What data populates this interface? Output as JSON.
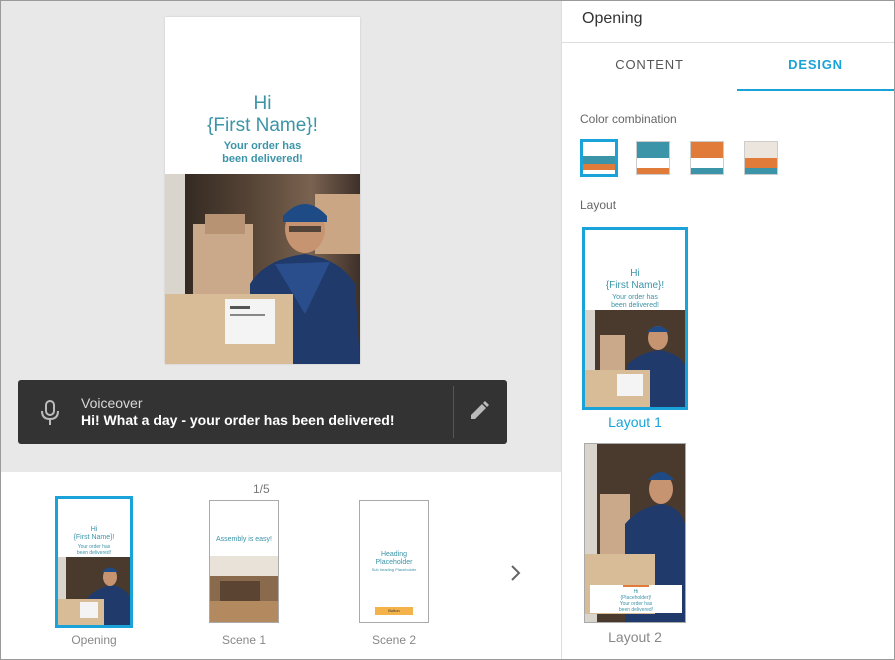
{
  "preview": {
    "hi": "Hi",
    "name": "{First Name}!",
    "sub_line1": "Your order has",
    "sub_line2": "been delivered!"
  },
  "voiceover": {
    "title": "Voiceover",
    "text": "Hi! What a day - your order has been delivered!"
  },
  "scenes": {
    "counter": "1/5",
    "items": [
      {
        "label": "Opening"
      },
      {
        "label": "Scene 1",
        "text": "Assembly is easy!"
      },
      {
        "label": "Scene 2",
        "heading1": "Heading",
        "heading2": "Placeholder",
        "subheading": "Sub heading Placeholder",
        "button": "Button"
      }
    ]
  },
  "panel": {
    "title": "Opening",
    "tabs": [
      "CONTENT",
      "DESIGN"
    ],
    "color_label": "Color combination",
    "layout_label": "Layout",
    "layouts": [
      {
        "label": "Layout 1",
        "hi": "Hi",
        "name": "{First Name}!",
        "sub1": "Your order has",
        "sub2": "been delivered!"
      },
      {
        "label": "Layout 2",
        "hi": "Hi",
        "name": "{Placeholder}!",
        "sub1": "Your order has",
        "sub2": "been delivered!"
      }
    ]
  },
  "colors": {
    "accent": "#19a3d9",
    "teal": "#3b94a8",
    "orange": "#e07b39",
    "beige": "#ece5dd",
    "dark": "#333333"
  }
}
